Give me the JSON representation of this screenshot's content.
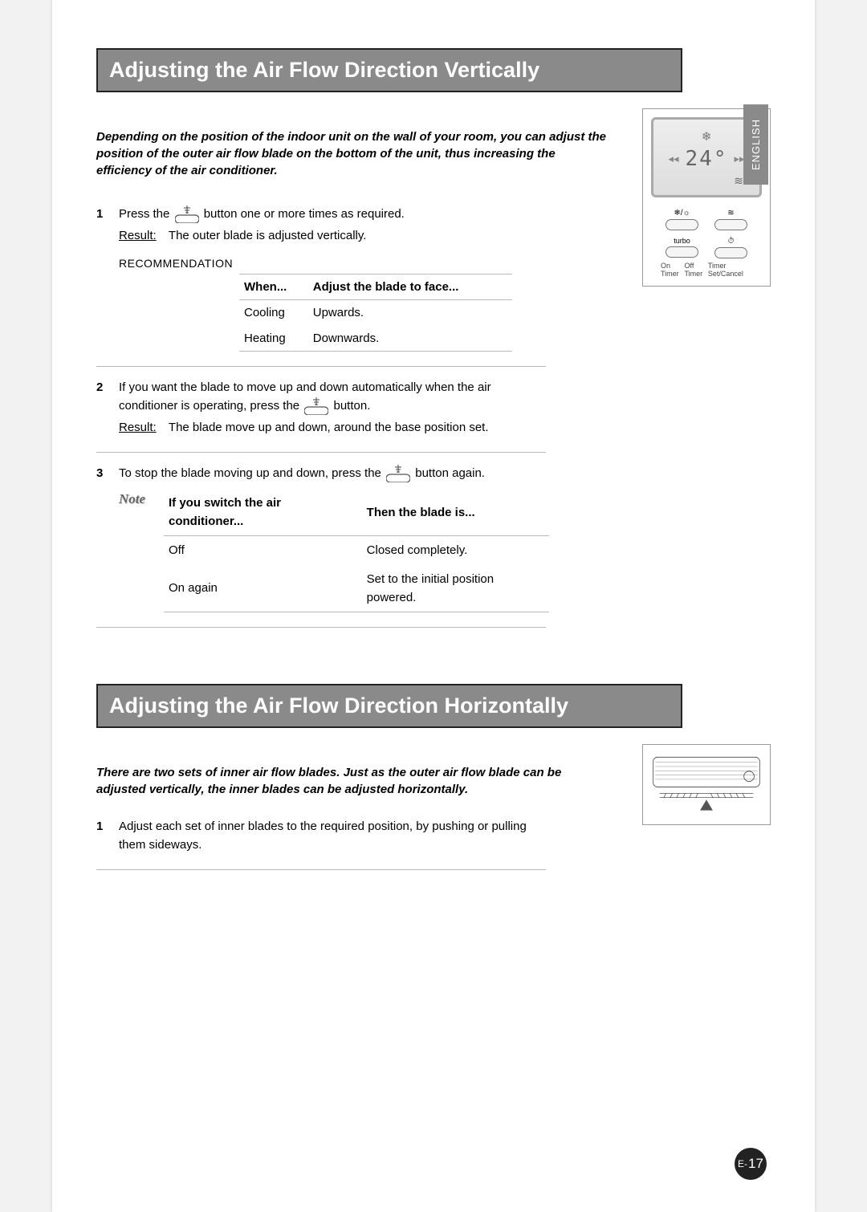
{
  "language_tab": "ENGLISH",
  "section1": {
    "title": "Adjusting the Air Flow Direction Vertically",
    "intro": "Depending on the position of the indoor unit on the wall of your room, you can adjust the position of the outer air flow blade on the bottom of the unit, thus increasing the efficiency of the air conditioner.",
    "step1": {
      "num": "1",
      "pre": "Press the",
      "post": "button one or more times as required.",
      "result_label": "Result:",
      "result": "The outer blade is adjusted vertically.",
      "recommendation_label": "RECOMMENDATION",
      "table": {
        "h1": "When...",
        "h2": "Adjust the blade to face...",
        "rows": [
          {
            "c1": "Cooling",
            "c2": "Upwards."
          },
          {
            "c1": "Heating",
            "c2": "Downwards."
          }
        ]
      }
    },
    "step2": {
      "num": "2",
      "pre": "If you want the blade to move up and down automatically when the air conditioner is operating, press the",
      "post": "button.",
      "result_label": "Result:",
      "result": "The blade move up and down, around the base position set."
    },
    "step3": {
      "num": "3",
      "pre": "To stop the blade moving up and down, press the",
      "post": "button again.",
      "note_label": "Note",
      "note_table": {
        "h1": "If you switch the air conditioner...",
        "h2": "Then the blade is...",
        "rows": [
          {
            "c1": "Off",
            "c2": "Closed completely."
          },
          {
            "c1": "On again",
            "c2": "Set to the initial position powered."
          }
        ]
      }
    }
  },
  "remote": {
    "snowflake": "❄",
    "temp": "24°",
    "arrow_left": "◂◂",
    "arrow_right": "▸▸",
    "swing_disp": "≋",
    "icons": [
      "❄/☼",
      "≋",
      "turbo",
      "⏱"
    ],
    "timer_labels": [
      "On Timer",
      "Off Timer",
      "Timer Set/Cancel"
    ]
  },
  "section2": {
    "title": "Adjusting the Air Flow Direction Horizontally",
    "intro": "There are two sets of inner air flow blades. Just as the outer air flow blade can be adjusted vertically, the inner blades can be adjusted horizontally.",
    "step1": {
      "num": "1",
      "text": "Adjust each set of inner blades to the required position, by pushing or pulling them sideways."
    }
  },
  "page_number_prefix": "E-",
  "page_number": "17"
}
